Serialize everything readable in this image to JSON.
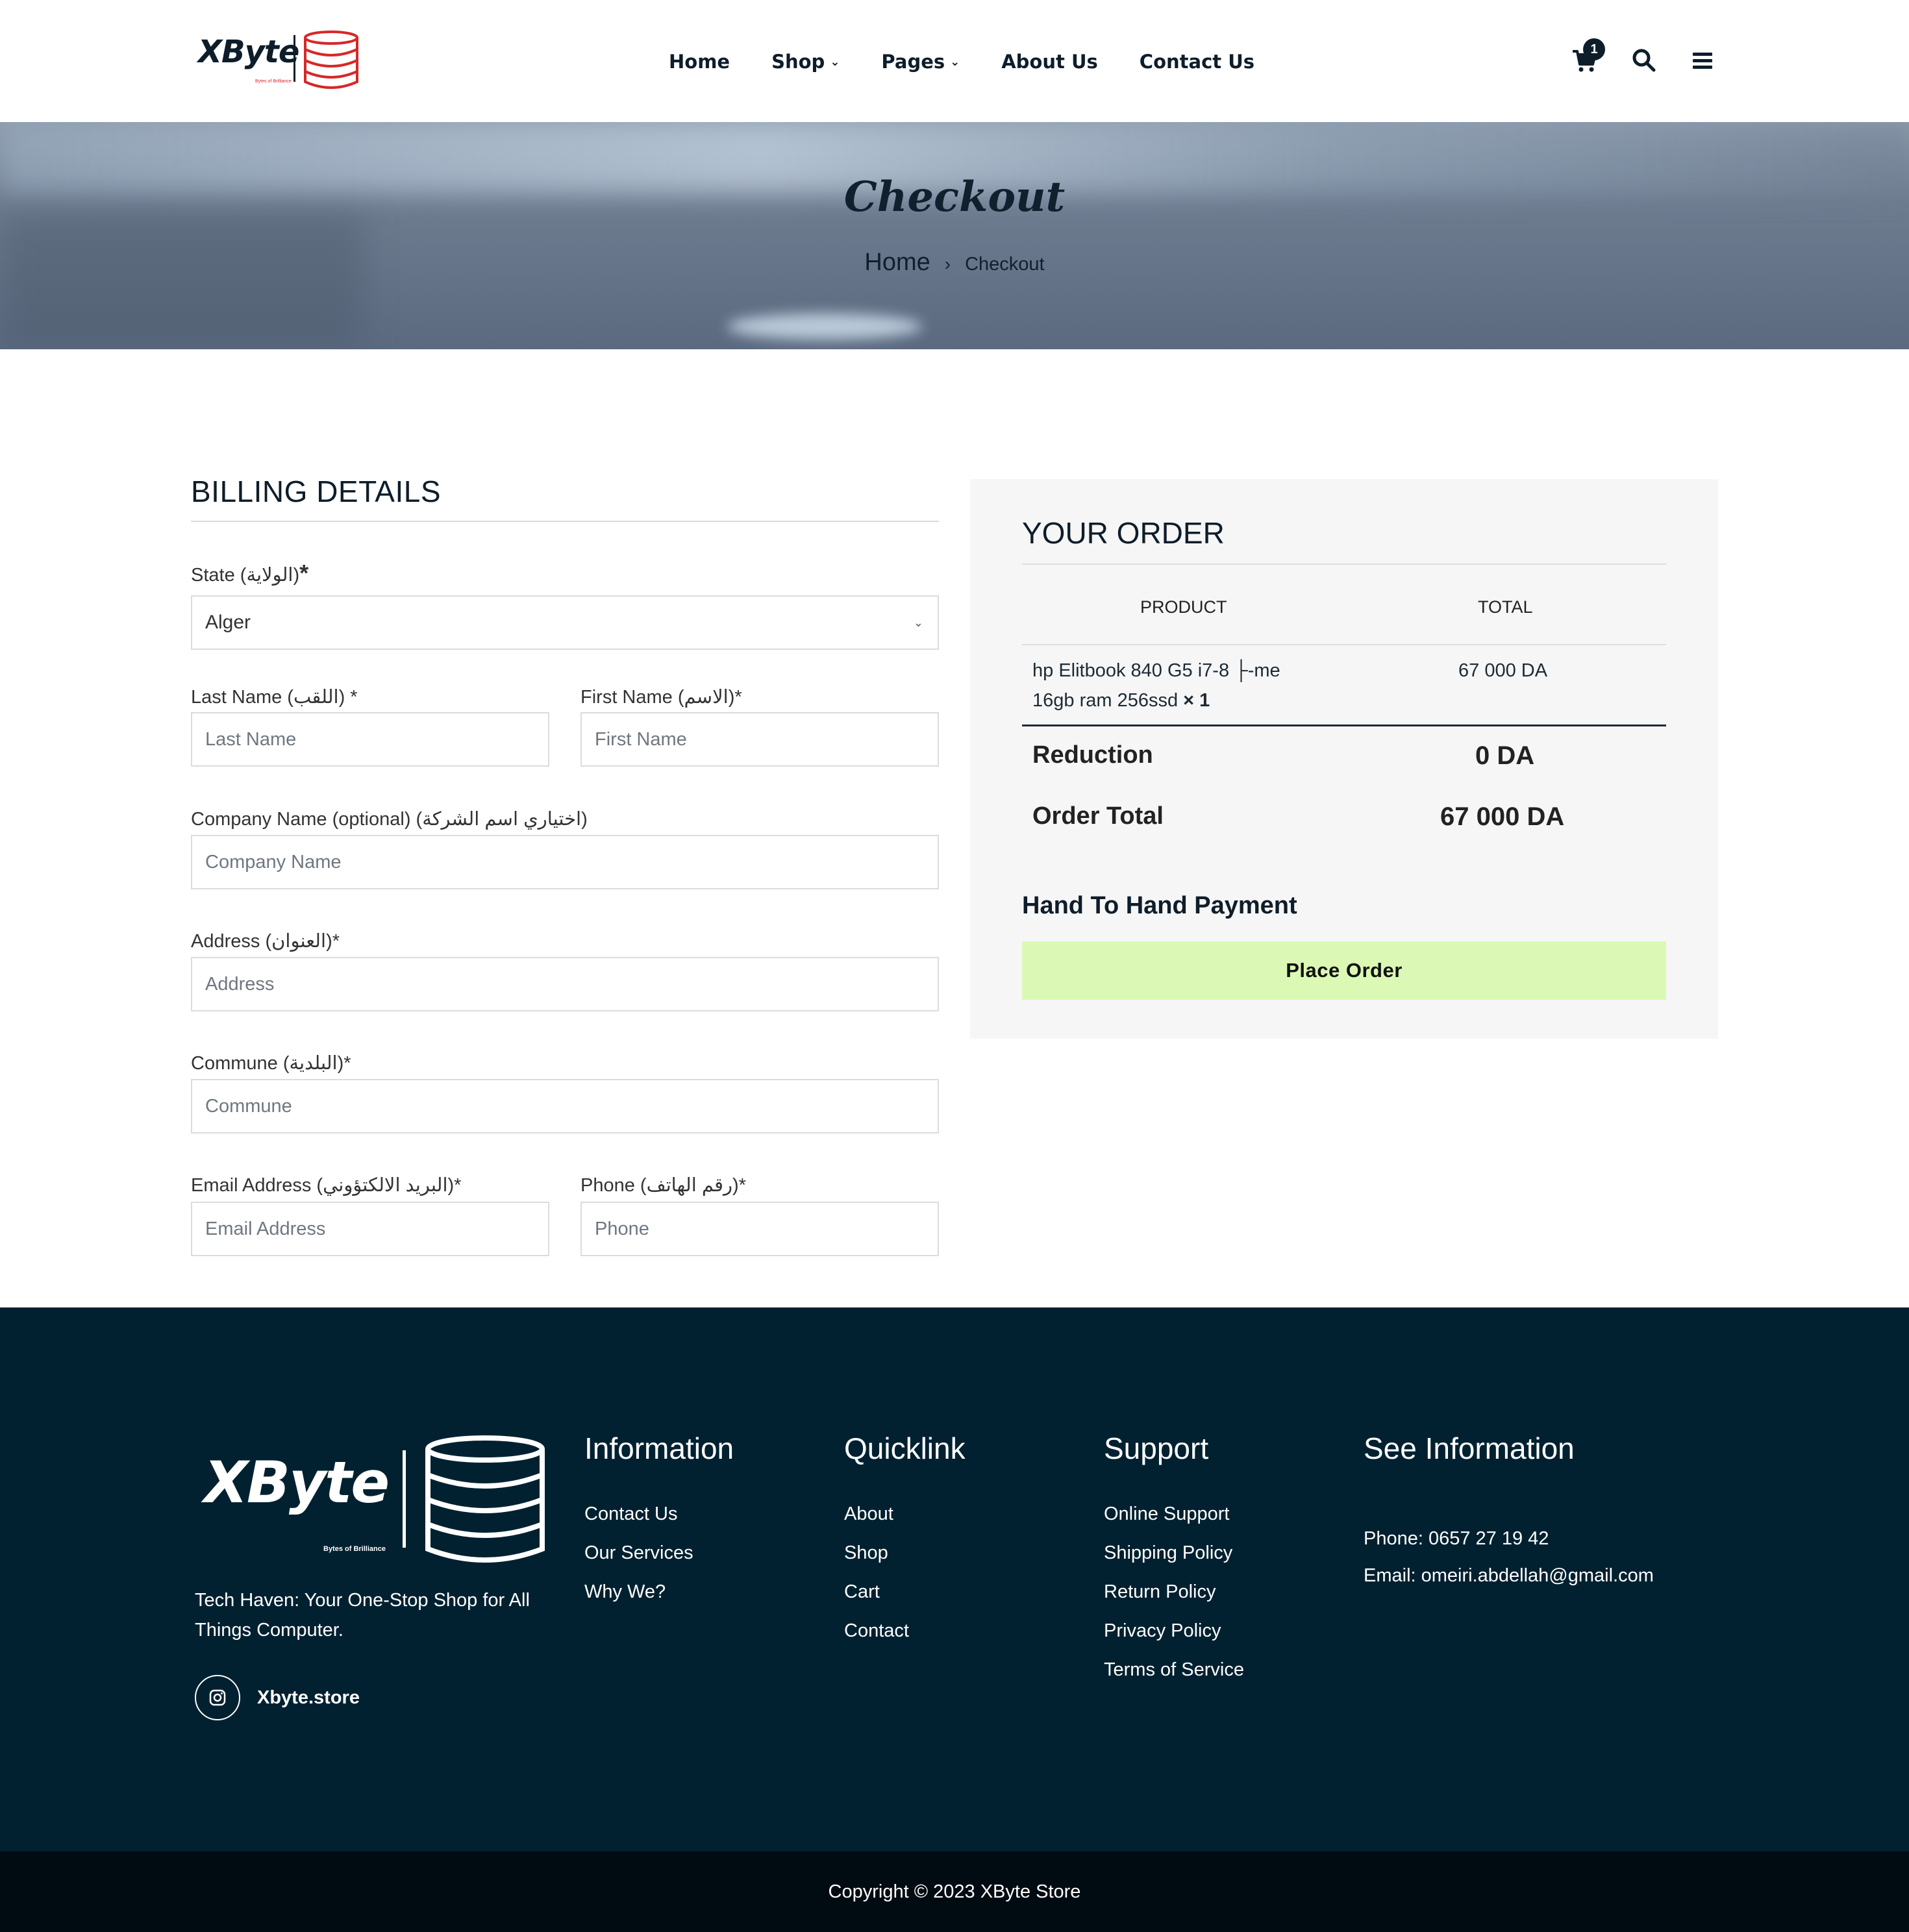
{
  "brand": {
    "name": "XByte",
    "tagline": "Bytes of Brilliance",
    "colors": {
      "dark": "#0e1d2a",
      "accent": "#d62828",
      "footer": "#022130",
      "button": "#dbf9b4"
    }
  },
  "nav": {
    "items": [
      {
        "label": "Home",
        "dropdown": false
      },
      {
        "label": "Shop",
        "dropdown": true
      },
      {
        "label": "Pages",
        "dropdown": true
      },
      {
        "label": "About Us",
        "dropdown": false
      },
      {
        "label": "Contact Us",
        "dropdown": false
      }
    ],
    "cart_count": "1",
    "icons": [
      "cart-icon",
      "search-icon",
      "menu-icon"
    ]
  },
  "hero": {
    "title": "Checkout",
    "breadcrumb": {
      "home": "Home",
      "separator": "›",
      "current": "Checkout"
    }
  },
  "billing": {
    "title": "BILLING DETAILS",
    "state": {
      "label": "State (الولاية)",
      "required_mark": "*",
      "value": "Alger"
    },
    "last_name": {
      "label": "Last Name (اللقب) *",
      "placeholder": "Last Name"
    },
    "first_name": {
      "label": "First Name (الاسم)*",
      "placeholder": "First Name"
    },
    "company": {
      "label": "Company Name (optional) (اختياري اسم الشركة)",
      "placeholder": "Company Name"
    },
    "address": {
      "label": "Address (العنوان)*",
      "placeholder": "Address"
    },
    "commune": {
      "label": "Commune (البلدية)*",
      "placeholder": "Commune"
    },
    "email": {
      "label": "Email Address (البريد الالكتؤوني)*",
      "placeholder": "Email Address"
    },
    "phone": {
      "label": "Phone (رقم الهاتف)*",
      "placeholder": "Phone"
    }
  },
  "order": {
    "title": "YOUR ORDER",
    "col_product": "PRODUCT",
    "col_total": "TOTAL",
    "item": {
      "name_line1": "hp Elitbook 840 G5 i7-8 ├-me",
      "name_line2": "16gb ram 256ssd",
      "qty": "× 1",
      "total": "67 000 DA"
    },
    "reduction_label": "Reduction",
    "reduction_value": "0 DA",
    "order_total_label": "Order Total",
    "order_total_value": "67 000 DA",
    "payment_method": "Hand To Hand Payment",
    "place_order": "Place Order"
  },
  "footer": {
    "description": "Tech Haven: Your One-Stop Shop for All Things Computer.",
    "social_handle": "Xbyte.store",
    "social_icon": "instagram-icon",
    "information": {
      "title": "Information",
      "links": [
        "Contact Us",
        "Our Services",
        "Why We?"
      ]
    },
    "quicklink": {
      "title": "Quicklink",
      "links": [
        "About",
        "Shop",
        "Cart",
        "Contact"
      ]
    },
    "support": {
      "title": "Support",
      "links": [
        "Online Support",
        "Shipping Policy",
        "Return Policy",
        "Privacy Policy",
        "Terms of Service"
      ]
    },
    "see_information": {
      "title": "See Information",
      "phone": "Phone: 0657 27 19 42",
      "email": "Email: omeiri.abdellah@gmail.com"
    },
    "copyright": "Copyright © 2023 XByte Store"
  }
}
